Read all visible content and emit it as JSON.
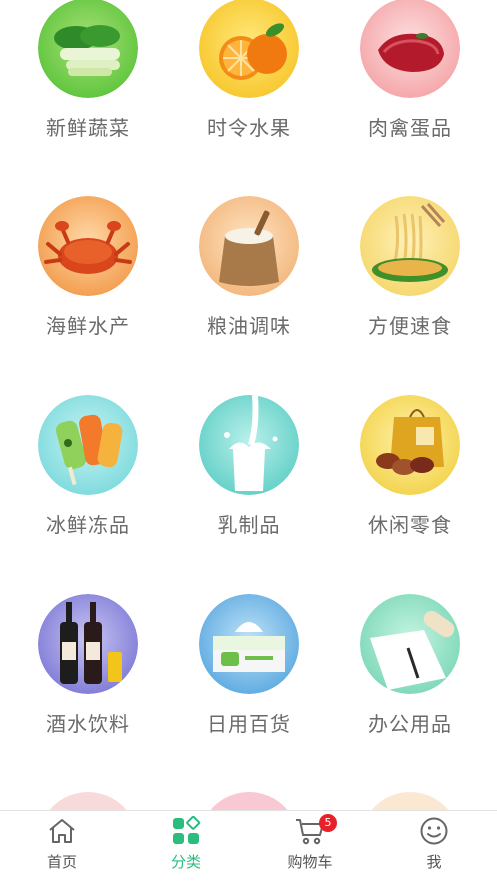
{
  "categories": [
    {
      "label": "新鲜蔬菜",
      "icon": "vegetables-image"
    },
    {
      "label": "时令水果",
      "icon": "fruit-image"
    },
    {
      "label": "肉禽蛋品",
      "icon": "meat-image"
    },
    {
      "label": "海鲜水产",
      "icon": "crab-image"
    },
    {
      "label": "粮油调味",
      "icon": "rice-sack-image"
    },
    {
      "label": "方便速食",
      "icon": "noodles-image"
    },
    {
      "label": "冰鲜冻品",
      "icon": "popsicle-image"
    },
    {
      "label": "乳制品",
      "icon": "milk-image"
    },
    {
      "label": "休闲零食",
      "icon": "snacks-image"
    },
    {
      "label": "酒水饮料",
      "icon": "wine-image"
    },
    {
      "label": "日用百货",
      "icon": "tissue-box-image"
    },
    {
      "label": "办公用品",
      "icon": "paper-pen-image"
    }
  ],
  "tabbar": {
    "tabs": [
      {
        "label": "首页",
        "icon": "home-icon"
      },
      {
        "label": "分类",
        "icon": "category-icon",
        "active": true
      },
      {
        "label": "购物车",
        "icon": "cart-icon",
        "badge": "5"
      },
      {
        "label": "我",
        "icon": "smiley-icon"
      }
    ]
  },
  "colors": {
    "accent": "#2bbd7e",
    "badge": "#e6212a",
    "label": "#6b6b6b"
  }
}
